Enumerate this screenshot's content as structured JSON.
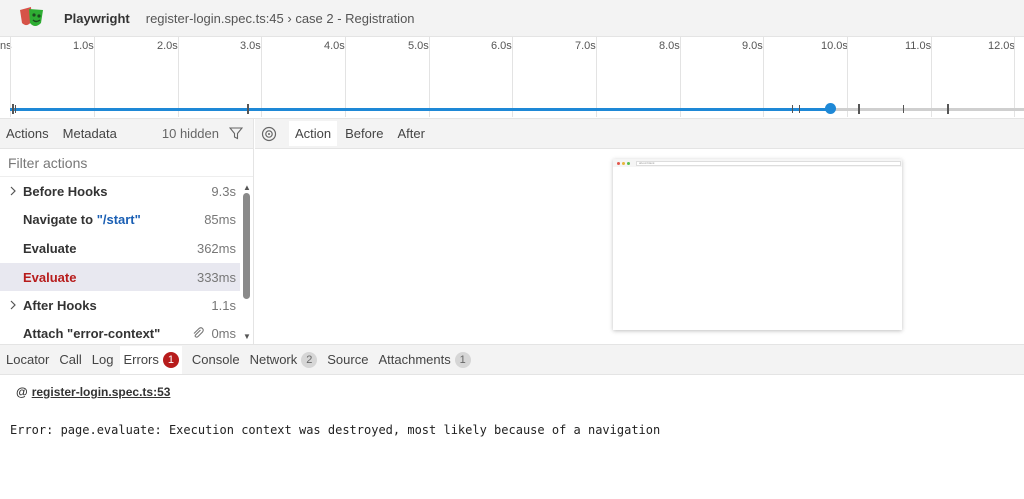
{
  "header": {
    "app_title": "Playwright",
    "breadcrumb": "register-login.spec.ts:45 › case 2 - Registration"
  },
  "timeline": {
    "ticks": [
      "ns",
      "1.0s",
      "2.0s",
      "3.0s",
      "4.0s",
      "5.0s",
      "6.0s",
      "7.0s",
      "8.0s",
      "9.0s",
      "10.0s",
      "11.0s",
      "12.0s"
    ]
  },
  "left_panel": {
    "tabs": [
      "Actions",
      "Metadata"
    ],
    "hidden_count": "10 hidden",
    "filter_placeholder": "Filter actions",
    "actions": [
      {
        "name": "Before Hooks",
        "duration": "9.3s",
        "expandable": true
      },
      {
        "name_prefix": "Navigate to ",
        "name_url": "\"/start\"",
        "duration": "85ms",
        "expandable": false
      },
      {
        "name": "Evaluate",
        "duration": "362ms",
        "expandable": false
      },
      {
        "name": "Evaluate",
        "duration": "333ms",
        "expandable": false,
        "selected": true
      },
      {
        "name": "After Hooks",
        "duration": "1.1s",
        "expandable": true
      },
      {
        "name": "Attach \"error-context\"",
        "duration": "0ms",
        "expandable": false
      }
    ]
  },
  "right_panel": {
    "tabs": [
      "Action",
      "Before",
      "After"
    ],
    "active_tab": "Action",
    "snapshot_url": "about:blank"
  },
  "bottom_panel": {
    "tabs": [
      {
        "label": "Locator"
      },
      {
        "label": "Call"
      },
      {
        "label": "Log"
      },
      {
        "label": "Errors",
        "badge": "1"
      },
      {
        "label": "Console"
      },
      {
        "label": "Network",
        "badge": "2"
      },
      {
        "label": "Source"
      },
      {
        "label": "Attachments",
        "badge": "1"
      }
    ],
    "active_tab": "Errors"
  },
  "error": {
    "at": "@",
    "location": "register-login.spec.ts:53",
    "message": "Error: page.evaluate: Execution context was destroyed, most likely because of a navigation"
  },
  "colors": {
    "accent": "#1e88d6",
    "error_badge": "#b71c1c",
    "selected_text": "#b71c1c",
    "url_text": "#1a5fb4"
  }
}
